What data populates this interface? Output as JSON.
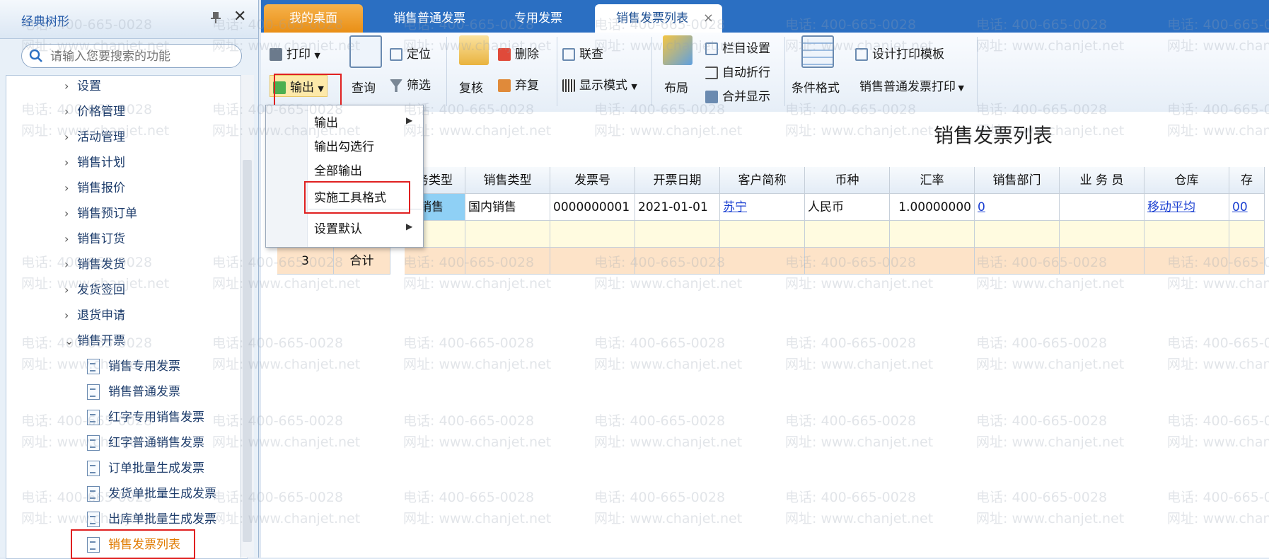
{
  "left_panel": {
    "title": "经典树形",
    "search_placeholder": "请输入您要搜索的功能",
    "tree_items": [
      {
        "label": "设置",
        "type": "collapsed"
      },
      {
        "label": "价格管理",
        "type": "collapsed"
      },
      {
        "label": "活动管理",
        "type": "collapsed"
      },
      {
        "label": "销售计划",
        "type": "collapsed"
      },
      {
        "label": "销售报价",
        "type": "collapsed"
      },
      {
        "label": "销售预订单",
        "type": "collapsed"
      },
      {
        "label": "销售订货",
        "type": "collapsed"
      },
      {
        "label": "销售发货",
        "type": "collapsed"
      },
      {
        "label": "发货签回",
        "type": "collapsed"
      },
      {
        "label": "退货申请",
        "type": "collapsed"
      },
      {
        "label": "销售开票",
        "type": "expanded"
      },
      {
        "label": "销售专用发票",
        "type": "leaf"
      },
      {
        "label": "销售普通发票",
        "type": "leaf"
      },
      {
        "label": "红字专用销售发票",
        "type": "leaf"
      },
      {
        "label": "红字普通销售发票",
        "type": "leaf"
      },
      {
        "label": "订单批量生成发票",
        "type": "leaf"
      },
      {
        "label": "发货单批量生成发票",
        "type": "leaf"
      },
      {
        "label": "出库单批量生成发票",
        "type": "leaf"
      },
      {
        "label": "销售发票列表",
        "type": "leaf-selected"
      }
    ]
  },
  "tabs": [
    {
      "label": "我的桌面"
    },
    {
      "label": "销售普通发票"
    },
    {
      "label": "专用发票"
    },
    {
      "label": "销售发票列表",
      "close": "×"
    }
  ],
  "toolbar": {
    "print": "打印",
    "locate": "定位",
    "export": "输出",
    "query": "查询",
    "filter": "筛选",
    "review": "复核",
    "delete": "删除",
    "abandon": "弃复",
    "joint_query": "联查",
    "display_mode": "显示模式",
    "layout": "布局",
    "column_settings": "栏目设置",
    "auto_wrap": "自动折行",
    "merge_display": "合并显示",
    "conditional_format": "条件格式",
    "design_print_template": "设计打印模板",
    "print_template_select": "销售普通发票打印"
  },
  "export_menu": {
    "items": [
      "输出",
      "输出勾选行",
      "全部输出",
      "实施工具格式",
      "设置默认"
    ]
  },
  "list": {
    "title": "销售发票列表",
    "columns": [
      "务类型",
      "销售类型",
      "发票号",
      "开票日期",
      "客户简称",
      "币种",
      "汇率",
      "销售部门",
      "业 务 员",
      "仓库",
      "存"
    ],
    "row1": [
      "通销售",
      "国内销售",
      "0000000001",
      "2021-01-01",
      "苏宁",
      "人民币",
      "1.00000000",
      "0",
      "",
      "移动平均",
      "00"
    ],
    "total_row": {
      "num": "3",
      "label": "合计"
    }
  },
  "watermark": {
    "phone": "电话: 400-665-0028",
    "site": "网址: www.chanjet.net"
  },
  "colors": {
    "accent": "#2b6fc2",
    "home_tab": "#f0a030",
    "highlight_red": "#e02020",
    "selected_text": "#e07b00"
  }
}
